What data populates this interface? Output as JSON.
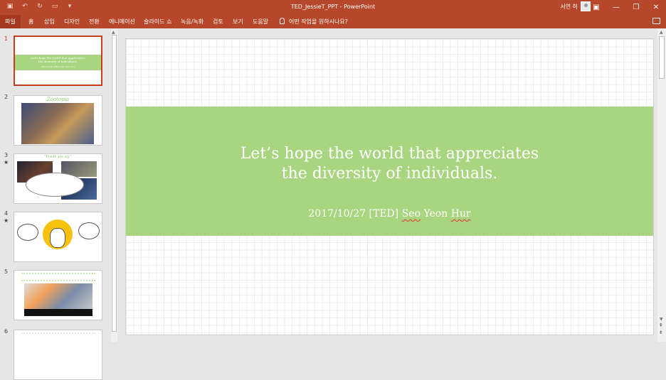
{
  "titlebar": {
    "doc_title": "TED_JessieT_PPT  -  PowerPoint",
    "user_name": "서연 허",
    "qat_icons": [
      "save-icon",
      "undo-icon",
      "redo-icon",
      "start-presentation-icon",
      "customize-qat-icon"
    ],
    "window_icons": [
      "ribbon-display-icon",
      "minimize-icon",
      "maximize-icon",
      "close-icon"
    ]
  },
  "menu": {
    "file": "파일",
    "tabs": [
      "홈",
      "삽입",
      "디자인",
      "전환",
      "애니메이션",
      "슬라이드 쇼",
      "녹음/녹화",
      "검토",
      "보기",
      "도움말"
    ],
    "tell_me": "어떤 작업을 원하시나요?"
  },
  "thumbnails": [
    {
      "num": "1",
      "star": "",
      "line1": "Let's hope the world that appreciates",
      "line2": "the diversity of individuals.",
      "sub": "2017/10/27 [TED] Seo Yeon Hur"
    },
    {
      "num": "2",
      "star": "",
      "title": "Zootopia"
    },
    {
      "num": "3",
      "star": "★",
      "title": "\"Preds are sly.\""
    },
    {
      "num": "4",
      "star": "★"
    },
    {
      "num": "5",
      "star": ""
    },
    {
      "num": "6",
      "star": ""
    }
  ],
  "slide": {
    "line1": "Let’s hope the world that appreciates",
    "line2": "the diversity of individuals.",
    "sub_prefix": "2017/10/27 [TED] ",
    "sub_name1": "Seo",
    "sub_name2": "Yeon",
    "sub_name3": "Hur",
    "band_color": "#a9d580"
  },
  "colors": {
    "accent": "#b7472a",
    "selected": "#c43e1c"
  }
}
